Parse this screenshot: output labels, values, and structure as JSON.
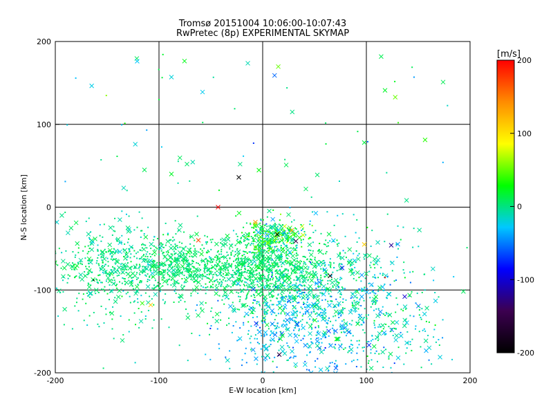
{
  "chart_data": {
    "type": "scatter",
    "title": "Tromsø 20151004 10:06:00-10:07:43",
    "subtitle": "RwPretec (8p) EXPERIMENTAL SKYMAP",
    "xlabel": "E-W location [km]",
    "ylabel": "N-S location [km]",
    "xlim": [
      -200,
      200
    ],
    "ylim": [
      -200,
      200
    ],
    "xticks": [
      "-200",
      "-100",
      "0",
      "100",
      "200"
    ],
    "yticks": [
      "-200",
      "-100",
      "0",
      "100",
      "200"
    ],
    "grid": true,
    "colorbar": {
      "unit_label": "[m/s]",
      "range": [
        -200,
        200
      ],
      "ticks": [
        "200",
        "100",
        "0",
        "-100",
        "-200"
      ],
      "colormap": [
        "#000000",
        "#3c0050",
        "#0000ff",
        "#00c8ff",
        "#00ff00",
        "#ffff00",
        "#ff8c00",
        "#ff0000"
      ]
    },
    "markers": [
      "dot",
      "x"
    ],
    "clusters": [
      {
        "x": -60,
        "y": -70,
        "sx": 70,
        "sy": 18,
        "count": 1100,
        "v": 5,
        "sv": 8
      },
      {
        "x": 10,
        "y": -85,
        "sx": 35,
        "sy": 25,
        "count": 500,
        "v": 5,
        "sv": 6
      },
      {
        "x": 10,
        "y": -35,
        "sx": 15,
        "sy": 12,
        "count": 250,
        "v": 15,
        "sv": 30
      },
      {
        "x": -140,
        "y": -75,
        "sx": 40,
        "sy": 40,
        "count": 300,
        "v": -5,
        "sv": 10
      },
      {
        "x": 40,
        "y": -140,
        "sx": 45,
        "sy": 35,
        "count": 600,
        "v": -30,
        "sv": 20
      },
      {
        "x": 80,
        "y": -90,
        "sx": 40,
        "sy": 40,
        "count": 250,
        "v": -10,
        "sv": 15
      },
      {
        "x": 130,
        "y": -150,
        "sx": 35,
        "sy": 30,
        "count": 120,
        "v": -5,
        "sv": 15
      }
    ],
    "sparse_region": {
      "x": [
        -195,
        195
      ],
      "y": [
        0,
        195
      ],
      "count": 60,
      "v": 0,
      "sv": 25
    },
    "outliers": [
      {
        "x": -43,
        "y": 0,
        "v": 200,
        "marker": "x"
      },
      {
        "x": -62,
        "y": -40,
        "v": 170,
        "marker": "x"
      },
      {
        "x": -108,
        "y": -118,
        "v": 110,
        "marker": "x"
      },
      {
        "x": 98,
        "y": -45,
        "v": 110,
        "marker": "x"
      },
      {
        "x": 124,
        "y": -46,
        "v": -120,
        "marker": "x"
      },
      {
        "x": 32,
        "y": -41,
        "v": -150,
        "marker": "x"
      },
      {
        "x": 16,
        "y": -178,
        "v": -160,
        "marker": "x"
      },
      {
        "x": 137,
        "y": -108,
        "v": -100,
        "marker": "x"
      },
      {
        "x": -23,
        "y": 36,
        "v": -200,
        "marker": "x"
      },
      {
        "x": 65,
        "y": -83,
        "v": -200,
        "marker": "x"
      },
      {
        "x": 14,
        "y": -33,
        "v": -200,
        "marker": "x"
      },
      {
        "x": -163,
        "y": -88,
        "v": -200,
        "marker": "dot"
      },
      {
        "x": 118,
        "y": -85,
        "v": 200,
        "marker": "dot"
      },
      {
        "x": 28,
        "y": -28,
        "v": 130,
        "marker": "x"
      },
      {
        "x": -7,
        "y": -18,
        "v": 140,
        "marker": "x"
      },
      {
        "x": -88,
        "y": 157,
        "v": -20,
        "marker": "x"
      },
      {
        "x": -58,
        "y": 139,
        "v": -25,
        "marker": "x"
      },
      {
        "x": 174,
        "y": 151,
        "v": 10,
        "marker": "x"
      },
      {
        "x": 118,
        "y": 141,
        "v": 20,
        "marker": "x"
      },
      {
        "x": 98,
        "y": 78,
        "v": 15,
        "marker": "x"
      },
      {
        "x": -114,
        "y": 45,
        "v": 10,
        "marker": "x"
      },
      {
        "x": -73,
        "y": 52,
        "v": 5,
        "marker": "x"
      },
      {
        "x": -88,
        "y": 40,
        "v": 20,
        "marker": "x"
      }
    ]
  }
}
